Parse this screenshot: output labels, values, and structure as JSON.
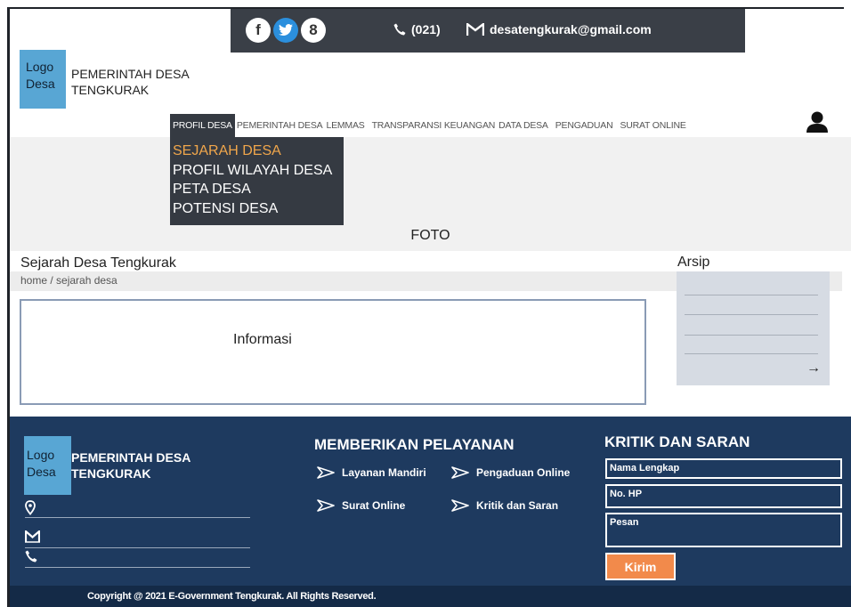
{
  "topbar": {
    "phone": "(021)",
    "email": "desatengkurak@gmail.com",
    "social": [
      {
        "icon": "facebook-icon",
        "glyph": "f"
      },
      {
        "icon": "twitter-icon",
        "glyph": "t"
      },
      {
        "icon": "google-plus-icon",
        "glyph": "8"
      }
    ]
  },
  "brand": {
    "logo_line1": "Logo",
    "logo_line2": "Desa",
    "name_line1": "PEMERINTAH DESA",
    "name_line2": "TENGKURAK"
  },
  "nav": {
    "items": [
      {
        "label": "PROFIL DESA",
        "active": true
      },
      {
        "label": "PEMERINTAH DESA",
        "active": false
      },
      {
        "label": "LEMMAS",
        "active": false
      },
      {
        "label": "TRANSPARANSI KEUANGAN",
        "active": false
      },
      {
        "label": "DATA DESA",
        "active": false
      },
      {
        "label": "PENGADUAN",
        "active": false
      },
      {
        "label": "SURAT ONLINE",
        "active": false
      }
    ],
    "user_icon": "user-icon"
  },
  "dropdown": {
    "items": [
      {
        "label": "SEJARAH DESA",
        "active": true
      },
      {
        "label": "PROFIL WILAYAH DESA",
        "active": false
      },
      {
        "label": "PETA DESA",
        "active": false
      },
      {
        "label": "POTENSI DESA",
        "active": false
      }
    ]
  },
  "hero": {
    "label": "FOTO"
  },
  "content": {
    "title": "Sejarah Desa Tengkurak",
    "breadcrumb": "home / sejarah desa",
    "info_label": "Informasi"
  },
  "archive": {
    "title": "Arsip",
    "arrow": "→"
  },
  "footer": {
    "logo_line1": "Logo",
    "logo_line2": "Desa",
    "name_line1": "PEMERINTAH DESA",
    "name_line2": "TENGKURAK",
    "services_title": "MEMBERIKAN PELAYANAN",
    "services": [
      {
        "label": "Layanan Mandiri"
      },
      {
        "label": "Pengaduan Online"
      },
      {
        "label": "Surat Online"
      },
      {
        "label": "Kritik dan Saran"
      }
    ],
    "feedback_title": "KRITIK DAN SARAN",
    "fields": {
      "name_placeholder": "Nama Lengkap",
      "phone_placeholder": "No. HP",
      "message_placeholder": "Pesan"
    },
    "submit_label": "Kirim",
    "copyright": "Copyright @ 2021 E-Government Tengkurak. All Rights Reserved."
  },
  "colors": {
    "topbar": "#3a3f47",
    "logo": "#58a6d4",
    "dropdown_active": "#f0a64b",
    "footer": "#1e3a5f",
    "button": "#f28a4b"
  }
}
